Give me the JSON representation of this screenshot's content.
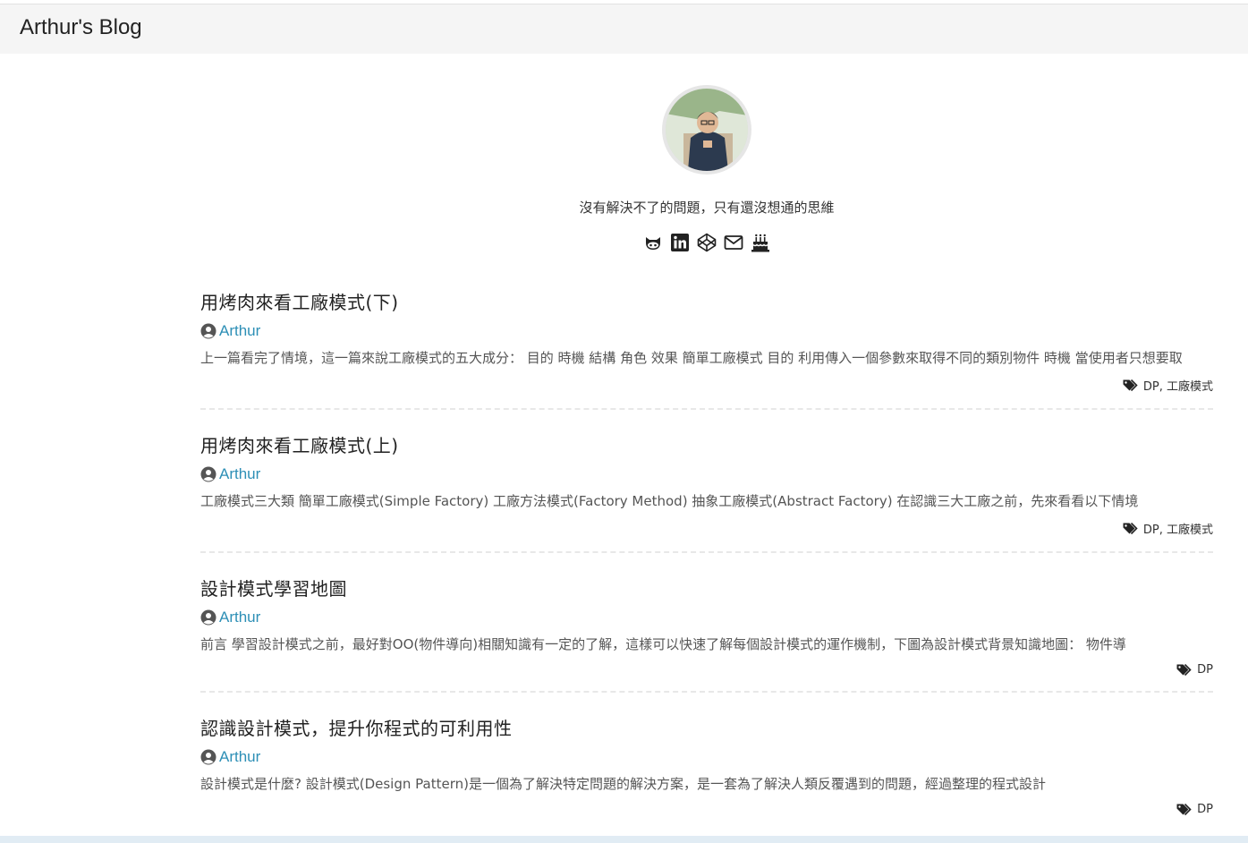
{
  "header": {
    "brand": "Arthur's Blog"
  },
  "profile": {
    "tagline": "沒有解決不了的問題，只有還沒想通的思維",
    "social_icons": [
      "github-icon",
      "linkedin-icon",
      "codepen-icon",
      "mail-icon",
      "cake-icon"
    ]
  },
  "posts": [
    {
      "title": "用烤肉來看工廠模式(下)",
      "author": "Arthur",
      "excerpt": "上一篇看完了情境，這一篇來說工廠模式的五大成分： 目的 時機 結構 角色 效果 簡單工廠模式 目的 利用傳入一個參數來取得不同的類別物件 時機 當使用者只想要取",
      "tags": "DP, 工廠模式"
    },
    {
      "title": "用烤肉來看工廠模式(上)",
      "author": "Arthur",
      "excerpt": "工廠模式三大類 簡單工廠模式(Simple Factory) 工廠方法模式(Factory Method) 抽象工廠模式(Abstract Factory) 在認識三大工廠之前，先來看看以下情境",
      "tags": "DP, 工廠模式"
    },
    {
      "title": "設計模式學習地圖",
      "author": "Arthur",
      "excerpt": "前言 學習設計模式之前，最好對OO(物件導向)相關知識有一定的了解，這樣可以快速了解每個設計模式的運作機制，下圖為設計模式背景知識地圖： 物件導",
      "tags": "DP"
    },
    {
      "title": "認識設計模式，提升你程式的可利用性",
      "author": "Arthur",
      "excerpt": "設計模式是什麼? 設計模式(Design Pattern)是一個為了解決特定問題的解決方案，是一套為了解決人類反覆遇到的問題，經過整理的程式設計",
      "tags": "DP"
    }
  ],
  "colors": {
    "link": "#2d8fb6",
    "navbar_bg": "#f5f5f5"
  }
}
